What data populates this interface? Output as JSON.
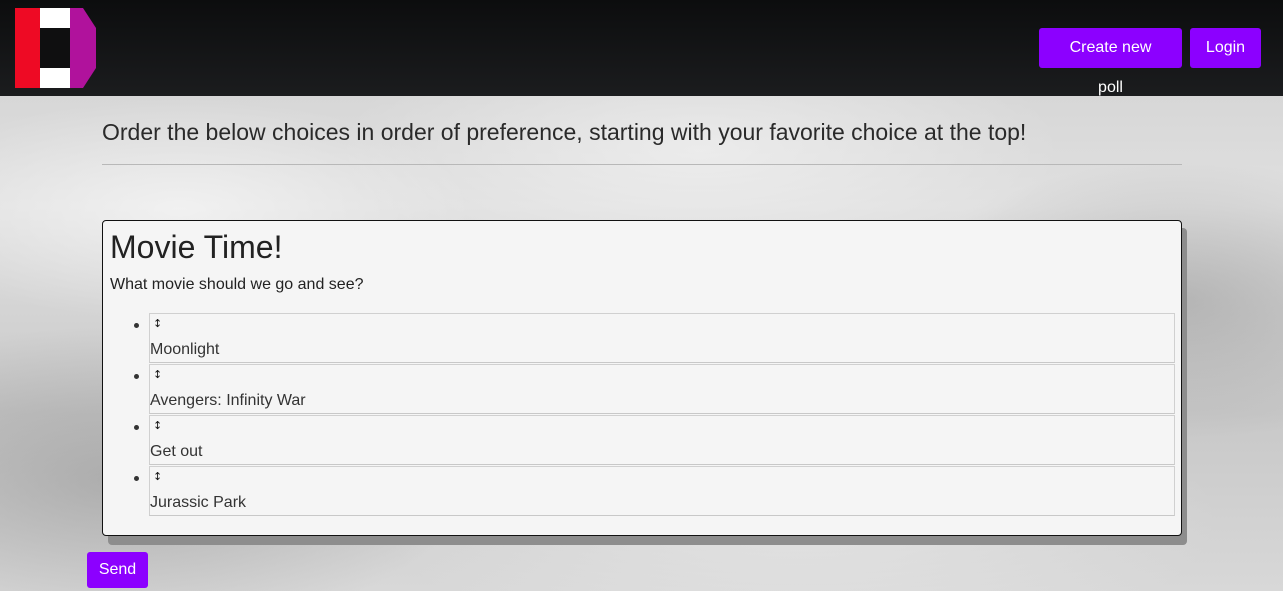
{
  "navbar": {
    "logo_icon": "ranked-choice-logo-icon",
    "create_poll_label": "Create new poll",
    "login_label": "Login"
  },
  "instructions": "Order the below choices in order of preference, starting with your favorite choice at the top!",
  "poll": {
    "title": "Movie Time!",
    "description": "What movie should we go and see?",
    "choices": [
      {
        "handle": "↕",
        "label": "Moonlight"
      },
      {
        "handle": "↕",
        "label": "Avengers: Infinity War"
      },
      {
        "handle": "↕",
        "label": "Get out"
      },
      {
        "handle": "↕",
        "label": "Jurassic Park"
      }
    ]
  },
  "send_label": "Send",
  "colors": {
    "accent": "#8c00ff",
    "navbar": "#141516",
    "logo_red": "#ee0a24",
    "logo_magenta": "#b0129c"
  }
}
